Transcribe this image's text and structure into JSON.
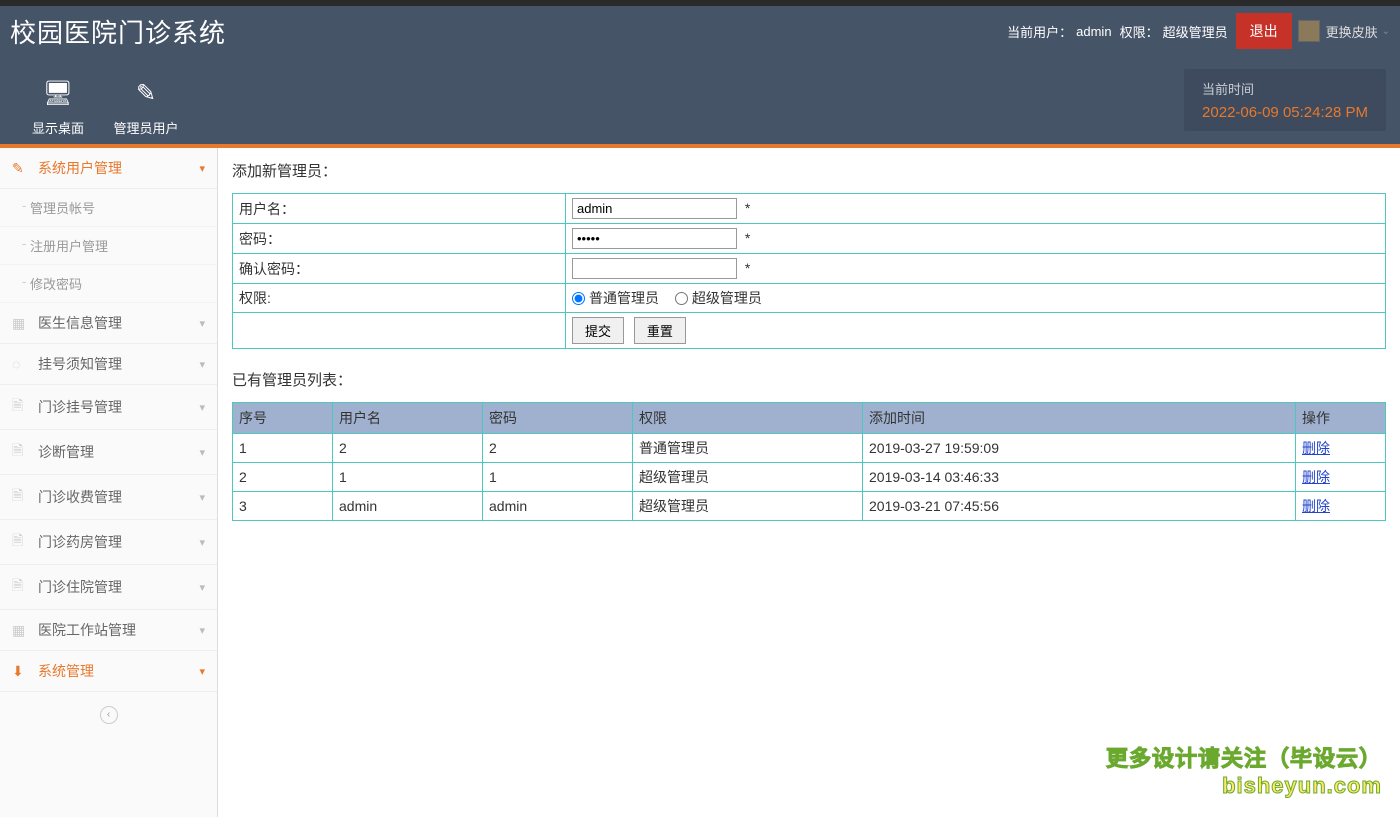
{
  "header": {
    "app_title": "校园医院门诊系统",
    "current_user_label": "当前用户：",
    "current_user": "admin",
    "role_label": "权限：",
    "role": "超级管理员",
    "logout": "退出",
    "skin": "更换皮肤"
  },
  "toolbar": {
    "items": [
      {
        "icon": "🖥",
        "label": "显示桌面"
      },
      {
        "icon": "✎",
        "label": "管理员用户"
      }
    ],
    "time_label": "当前时间",
    "time_value": "2022-06-09 05:24:28 PM"
  },
  "sidebar": {
    "items": [
      {
        "label": "系统用户管理",
        "active": true,
        "expanded": true,
        "icon": "✎",
        "children": [
          "管理员帐号",
          "注册用户管理",
          "修改密码"
        ]
      },
      {
        "label": "医生信息管理",
        "icon": "▦"
      },
      {
        "label": "挂号须知管理",
        "icon": "◌"
      },
      {
        "label": "门诊挂号管理",
        "icon": "🗎"
      },
      {
        "label": "诊断管理",
        "icon": "🗎"
      },
      {
        "label": "门诊收费管理",
        "icon": "🗎"
      },
      {
        "label": "门诊药房管理",
        "icon": "🗎"
      },
      {
        "label": "门诊住院管理",
        "icon": "🗎"
      },
      {
        "label": "医院工作站管理",
        "icon": "▦"
      },
      {
        "label": "系统管理",
        "active": true,
        "icon": "⬇"
      }
    ]
  },
  "form": {
    "section_title": "添加新管理员：",
    "username_label": "用户名：",
    "username_value": "admin",
    "password_label": "密码：",
    "password_value": "•••••",
    "confirm_label": "确认密码：",
    "confirm_value": "",
    "perm_label": "权限:",
    "perm_opt1": "普通管理员",
    "perm_opt2": "超级管理员",
    "required": "*",
    "submit": "提交",
    "reset": "重置"
  },
  "list": {
    "title": "已有管理员列表：",
    "headers": [
      "序号",
      "用户名",
      "密码",
      "权限",
      "添加时间",
      "操作"
    ],
    "delete_label": "删除",
    "rows": [
      {
        "seq": "1",
        "user": "2",
        "pwd": "2",
        "role": "普通管理员",
        "time": "2019-03-27 19:59:09"
      },
      {
        "seq": "2",
        "user": "1",
        "pwd": "1",
        "role": "超级管理员",
        "time": "2019-03-14 03:46:33"
      },
      {
        "seq": "3",
        "user": "admin",
        "pwd": "admin",
        "role": "超级管理员",
        "time": "2019-03-21 07:45:56"
      }
    ]
  },
  "watermark": {
    "line1": "更多设计请关注（毕设云）",
    "line2": "bisheyun.com"
  }
}
